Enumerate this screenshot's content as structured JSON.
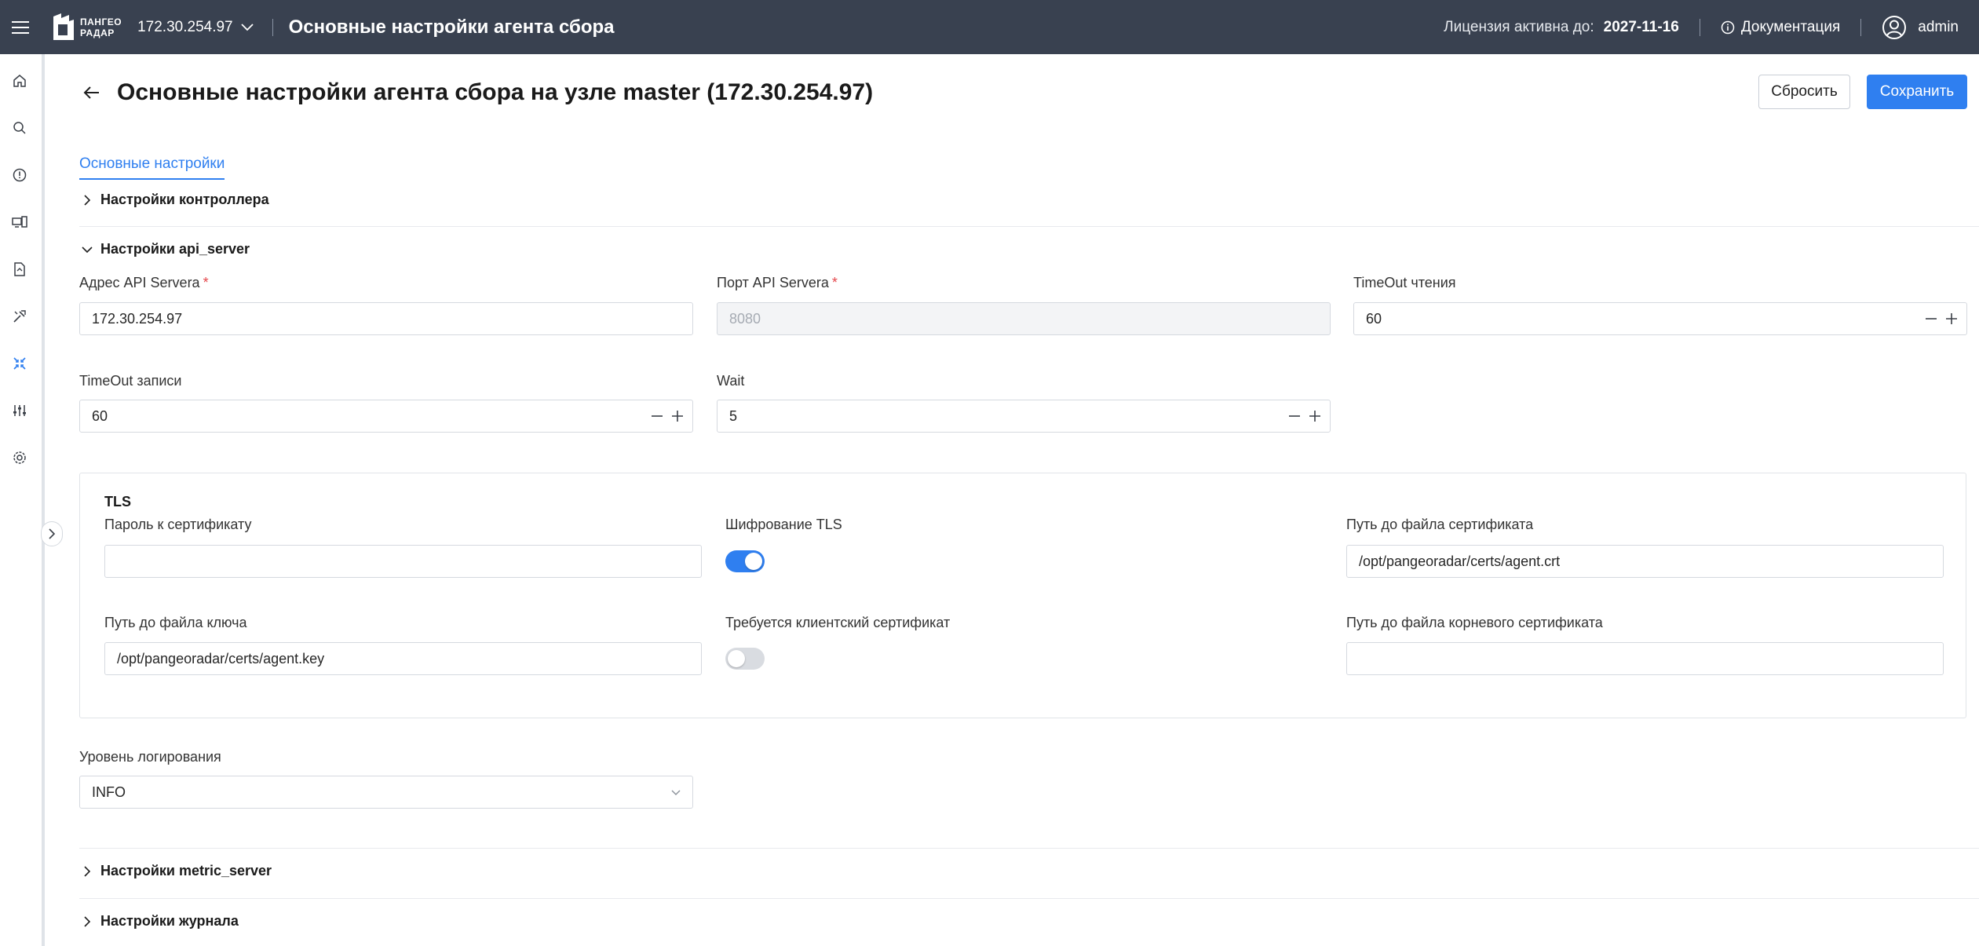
{
  "header": {
    "logo_line1": "ПАНГЕО",
    "logo_line2": "РАДАР",
    "host": "172.30.254.97",
    "title": "Основные настройки агента сбора",
    "license_label": "Лицензия активна до:",
    "license_date": "2027-11-16",
    "docs_label": "Документация",
    "user": "admin"
  },
  "sidebar": {
    "items": [
      "home-icon",
      "search-icon",
      "info-icon",
      "devices-icon",
      "report-icon",
      "tools-icon",
      "agents-icon",
      "sliders-icon",
      "settings-icon"
    ],
    "active_index": 6,
    "active_color": "#2f7ff0"
  },
  "page": {
    "title": "Основные настройки агента сбора на узле master (172.30.254.97)",
    "reset_label": "Сбросить",
    "save_label": "Сохранить",
    "accent_color": "#2f7ff0"
  },
  "tabs": [
    {
      "label": "Основные настройки",
      "active": true
    }
  ],
  "sections": {
    "controller": {
      "label": "Настройки контроллера",
      "expanded": false
    },
    "api_server": {
      "label": "Настройки api_server",
      "expanded": true
    },
    "metric_server": {
      "label": "Настройки metric_server",
      "expanded": false
    },
    "journal": {
      "label": "Настройки журнала",
      "expanded": false
    }
  },
  "api_server": {
    "address": {
      "label": "Адрес API Servera",
      "required_mark": "*",
      "value": "172.30.254.97"
    },
    "port": {
      "label": "Порт API Servera",
      "required_mark": "*",
      "value": "8080",
      "disabled": true
    },
    "read_timeout": {
      "label": "TimeOut чтения",
      "value": "60"
    },
    "write_timeout": {
      "label": "TimeOut записи",
      "value": "60"
    },
    "wait": {
      "label": "Wait",
      "value": "5"
    },
    "tls": {
      "title": "TLS",
      "cert_password": {
        "label": "Пароль к сертификату",
        "value": ""
      },
      "encryption": {
        "label": "Шифрование TLS",
        "on": true
      },
      "cert_path": {
        "label": "Путь до файла сертификата",
        "value": "/opt/pangeoradar/certs/agent.crt"
      },
      "key_path": {
        "label": "Путь до файла ключа",
        "value": "/opt/pangeoradar/certs/agent.key"
      },
      "client_cert": {
        "label": "Требуется клиентский сертификат",
        "on": false
      },
      "root_cert_path": {
        "label": "Путь до файла корневого сертификата",
        "value": ""
      }
    },
    "log_level": {
      "label": "Уровень логирования",
      "value": "INFO"
    }
  }
}
